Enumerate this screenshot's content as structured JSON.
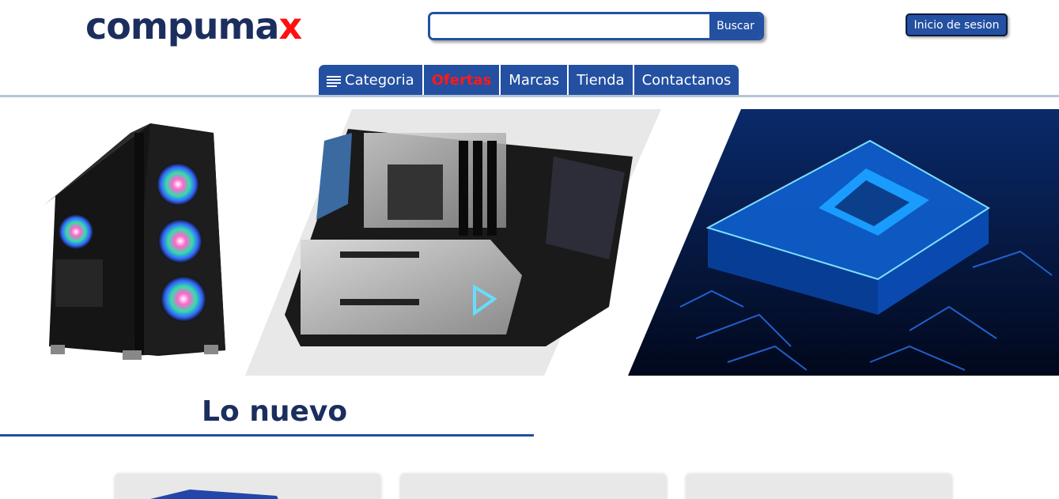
{
  "brand": {
    "name_main": "compuma",
    "name_accent": "x",
    "accent_color": "#ff1010",
    "primary_color": "#1b2e5e"
  },
  "search": {
    "placeholder": "",
    "value": "",
    "button_label": "Buscar"
  },
  "header": {
    "login_label": "Inicio de sesion"
  },
  "nav": {
    "items": [
      {
        "label": "Categoria",
        "icon": "menu-icon"
      },
      {
        "label": "Ofertas"
      },
      {
        "label": "Marcas"
      },
      {
        "label": "Tienda"
      },
      {
        "label": "Contactanos"
      }
    ]
  },
  "banner": {
    "panels": [
      "pc-case-image",
      "motherboard-image",
      "processor-chip-image"
    ]
  },
  "section": {
    "title": "Lo nuevo"
  },
  "colors": {
    "nav_bg": "#2350a1",
    "divider": "#b7c5d9",
    "offer_text": "#ff1a1a"
  }
}
